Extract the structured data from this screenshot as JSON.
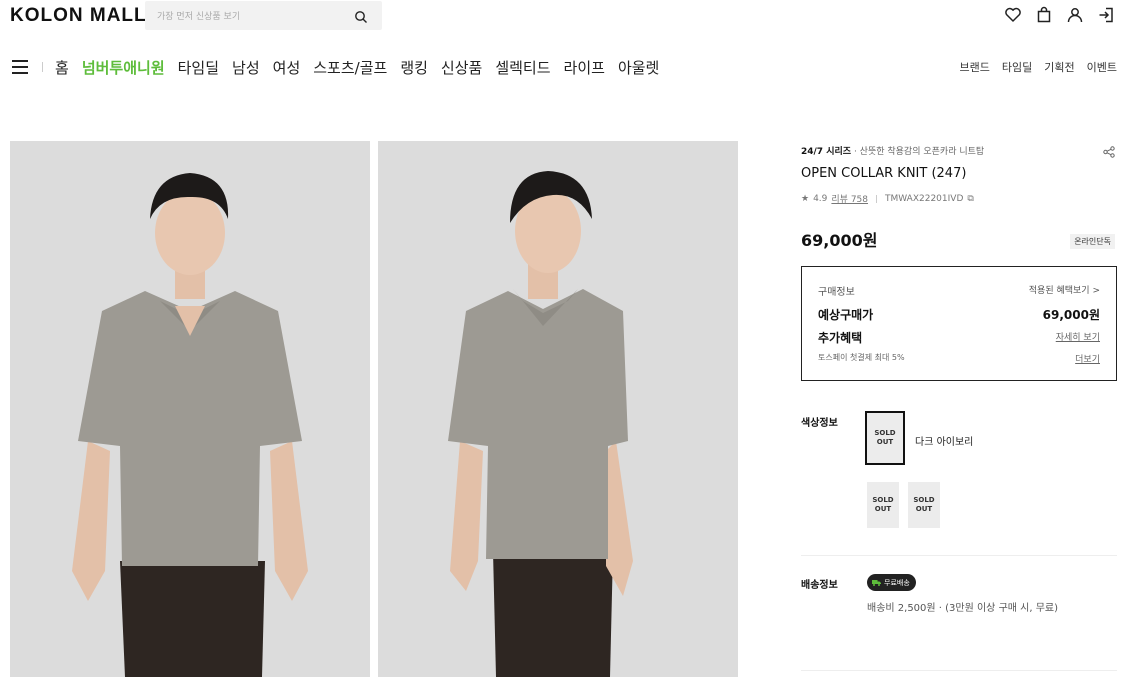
{
  "header": {
    "logo": "KOLON MALL",
    "search_placeholder": "가장 먼저 신상품 보기",
    "icons": [
      "heart-icon",
      "bag-icon",
      "user-icon",
      "login-icon"
    ]
  },
  "nav": {
    "items": [
      {
        "label": "홈",
        "highlight": false
      },
      {
        "label": "넘버투애니원",
        "highlight": true
      },
      {
        "label": "타임딜",
        "highlight": false
      },
      {
        "label": "남성",
        "highlight": false
      },
      {
        "label": "여성",
        "highlight": false
      },
      {
        "label": "스포츠/골프",
        "highlight": false
      },
      {
        "label": "랭킹",
        "highlight": false
      },
      {
        "label": "신상품",
        "highlight": false
      },
      {
        "label": "셀렉티드",
        "highlight": false
      },
      {
        "label": "라이프",
        "highlight": false
      },
      {
        "label": "아울렛",
        "highlight": false
      }
    ],
    "right": [
      "브랜드",
      "타임딜",
      "기획전",
      "이벤트"
    ],
    "highlight_color": "#5ebd3b"
  },
  "product": {
    "series": "24/7 시리즈",
    "series_sub": "산뜻한 착용감의 오픈카라 니트탑",
    "title": "OPEN COLLAR KNIT (247)",
    "rating": "4.9",
    "review_label": "리뷰 758",
    "code": "TMWAX22201IVD",
    "price": "69,000원",
    "badge": "온라인단독"
  },
  "buybox": {
    "purchase_info": "구매정보",
    "applied_benefits": "적용된 혜택보기 >",
    "expected_label": "예상구매가",
    "expected_price": "69,000원",
    "extra_label": "추가혜택",
    "detail_link": "자세히 보기",
    "toss_text": "토스페이 첫결제 최대 5%",
    "more_link": "더보기"
  },
  "color": {
    "label": "색상정보",
    "selected_name": "다크 아이보리",
    "sold_out": "SOLD OUT"
  },
  "shipping": {
    "label": "배송정보",
    "badge": "무료배송",
    "text": "배송비 2,500원 · (3만원 이상 구매 시, 무료)"
  }
}
